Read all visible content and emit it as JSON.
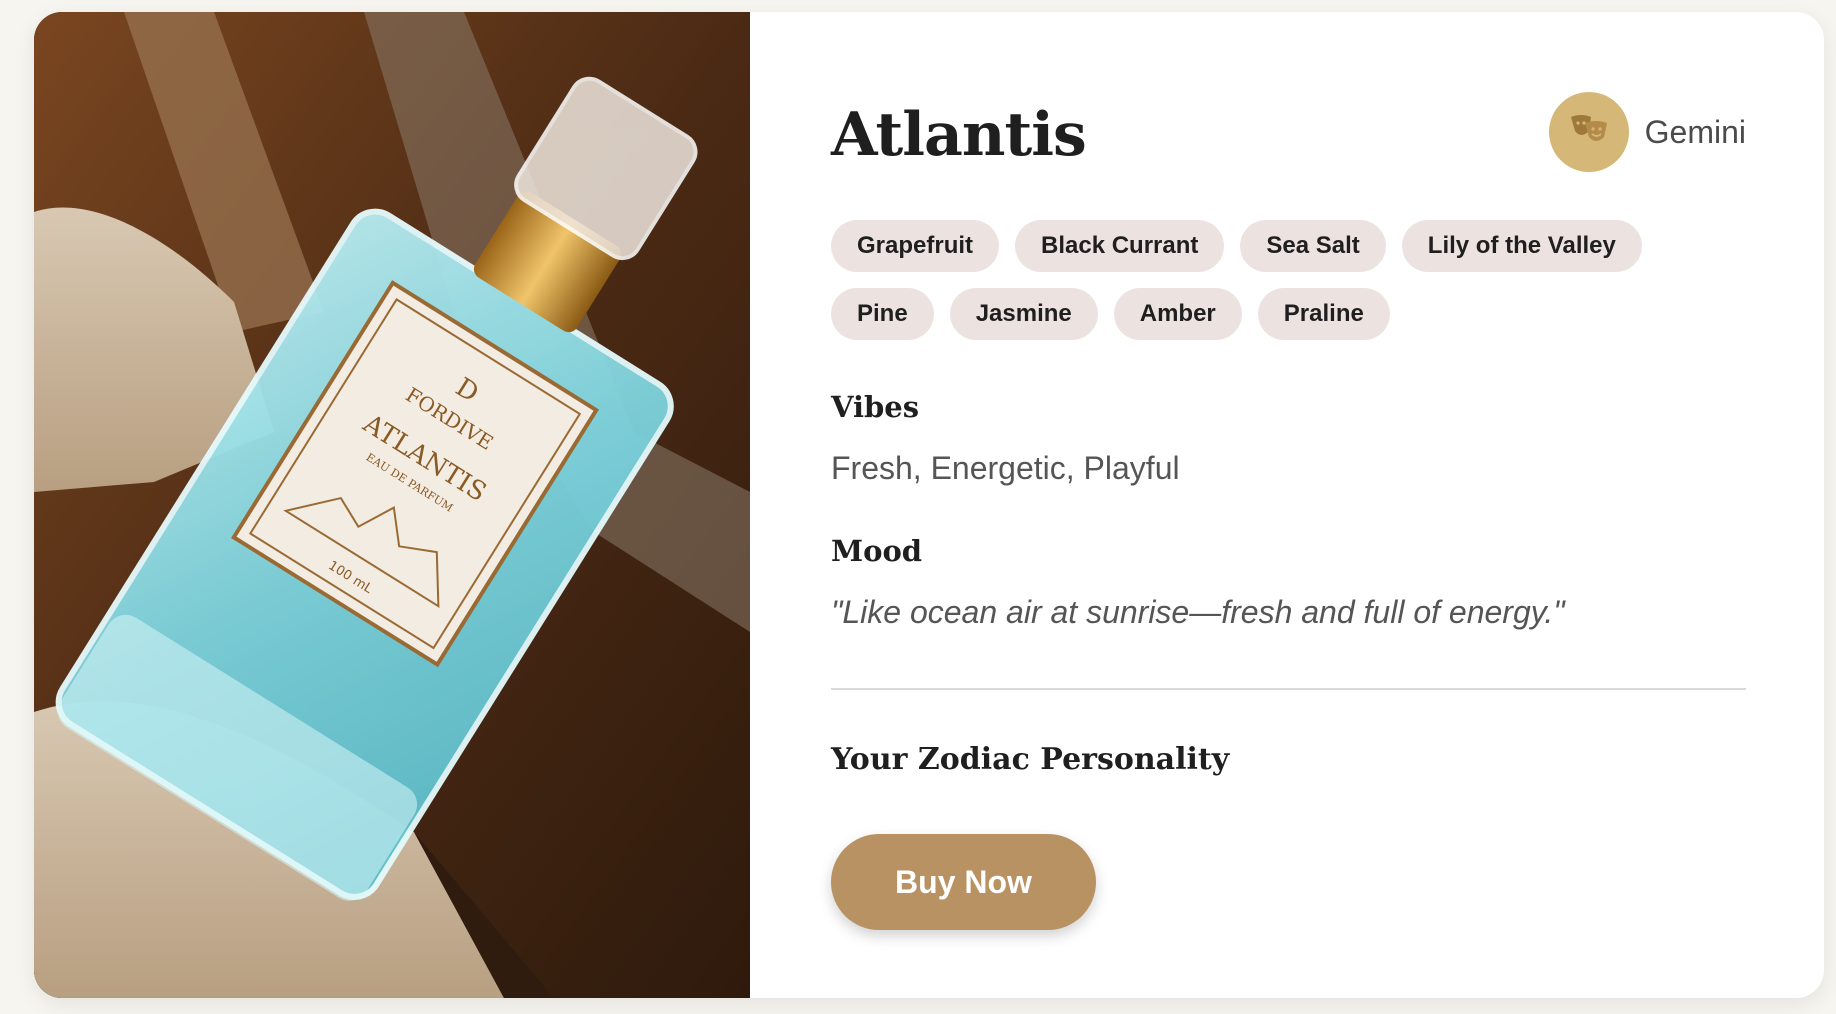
{
  "product": {
    "name": "Atlantis",
    "image_label": {
      "brand": "FORDIVE",
      "name": "ATLANTIS",
      "type": "EAU DE PARFUM",
      "volume": "100 mL"
    }
  },
  "zodiac": {
    "icon": "theater-masks-icon",
    "sign": "Gemini"
  },
  "notes": [
    "Grapefruit",
    "Black Currant",
    "Sea Salt",
    "Lily of the Valley",
    "Pine",
    "Jasmine",
    "Amber",
    "Praline"
  ],
  "vibes": {
    "label": "Vibes",
    "text": "Fresh, Energetic, Playful"
  },
  "mood": {
    "label": "Mood",
    "text": "\"Like ocean air at sunrise—fresh and full of energy.\""
  },
  "personality": {
    "label": "Your Zodiac Personality"
  },
  "actions": {
    "buy_label": "Buy Now"
  },
  "colors": {
    "accent": "#b99263",
    "badge": "#d5b877",
    "chip": "#ece3e1"
  }
}
